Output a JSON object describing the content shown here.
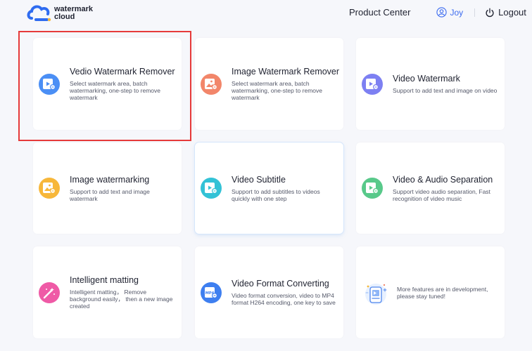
{
  "brand": {
    "line1": "watermark",
    "line2": "cloud"
  },
  "nav": {
    "product_center": "Product Center",
    "user": "Joy",
    "logout": "Logout"
  },
  "cards": [
    {
      "title": "Vedio Watermark Remover",
      "desc": "Select watermark area, batch watermarking, one-step to remove watermark",
      "icon": "video-file-icon",
      "color": "#4b8ff5"
    },
    {
      "title": "Image Watermark Remover",
      "desc": "Select watermark area, batch watermarking, one-step to remove watermark",
      "icon": "image-file-icon",
      "color": "#f2866a"
    },
    {
      "title": "Video Watermark",
      "desc": "Support to add text and image on video",
      "icon": "video-file-icon",
      "color": "#7d80f2"
    },
    {
      "title": "Image watermarking",
      "desc": "Support to add text and image watermark",
      "icon": "image-file-icon",
      "color": "#f7b73a"
    },
    {
      "title": "Video Subtitle",
      "desc": "Support to add subtitles to videos quickly with one step",
      "icon": "video-file-icon",
      "color": "#33c2d6"
    },
    {
      "title": "Video & Audio Separation",
      "desc": "Support video audio separation, Fast recognition of video music",
      "icon": "video-file-icon",
      "color": "#58c98a"
    },
    {
      "title": "Intelligent matting",
      "desc": "Intelligent matting， Remove background easily， then a new image created",
      "icon": "magic-wand-icon",
      "color": "#ef5aa6"
    },
    {
      "title": "Video Format Converting",
      "desc": "Video format conversion, video to MP4 format H264 encoding, one key to save",
      "icon": "mp4-file-icon",
      "color": "#3e7ff0",
      "icon_label": "MP4"
    },
    {
      "title": "",
      "desc": "More features are in development, please stay tuned!",
      "icon": "development-illustration-icon",
      "color": "#6aa0f5"
    }
  ]
}
